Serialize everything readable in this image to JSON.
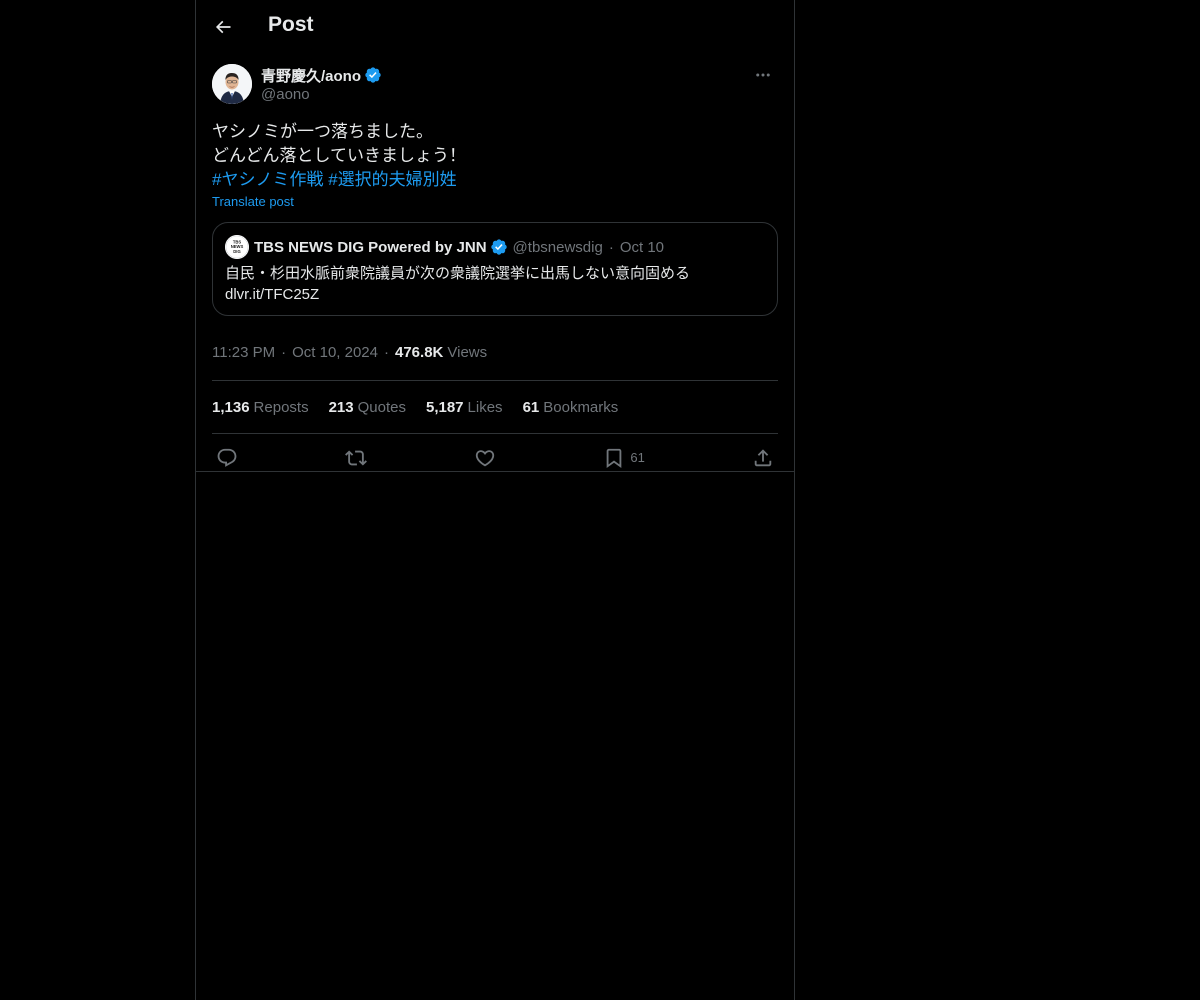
{
  "header": {
    "title": "Post"
  },
  "post": {
    "author": {
      "name": "青野慶久/aono",
      "handle": "@aono",
      "verified": true
    },
    "text_lines": [
      "ヤシノミが一つ落ちました。",
      "どんどん落としていきましょう！"
    ],
    "hashtags": [
      "#ヤシノミ作戦",
      "#選択的夫婦別姓"
    ],
    "translate_label": "Translate post",
    "quote": {
      "name": "TBS NEWS DIG Powered by JNN",
      "handle": "@tbsnewsdig",
      "date": "Oct 10",
      "text": "自民・杉田水脈前衆院議員が次の衆議院選挙に出馬しない意向固める",
      "link": "dlvr.it/TFC25Z",
      "verified": true
    },
    "meta": {
      "time": "11:23 PM",
      "date": "Oct 10, 2024",
      "views_count": "476.8K",
      "views_label": "Views"
    },
    "stats": {
      "reposts_count": "1,136",
      "reposts_label": "Reposts",
      "quotes_count": "213",
      "quotes_label": "Quotes",
      "likes_count": "5,187",
      "likes_label": "Likes",
      "bookmarks_count": "61",
      "bookmarks_label": "Bookmarks"
    },
    "actions": {
      "bookmark_count": "61"
    }
  },
  "colors": {
    "background": "#000000",
    "text": "#e7e9ea",
    "secondary": "#71767b",
    "accent": "#1d9bf0",
    "border": "#2f3336"
  }
}
